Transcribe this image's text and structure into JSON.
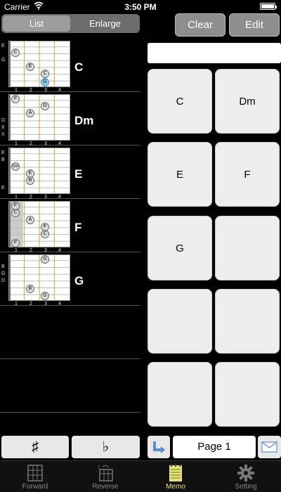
{
  "status": {
    "carrier": "Carrier",
    "time": "3:50 PM"
  },
  "segment": {
    "list": "List",
    "enlarge": "Enlarge"
  },
  "top_buttons": {
    "clear": "Clear",
    "edit": "Edit"
  },
  "chords": [
    {
      "name": "C",
      "open_labels": [
        "E",
        "G"
      ],
      "frets": [
        "1",
        "2",
        "3",
        "4"
      ],
      "dots": [
        "C",
        "E",
        "C",
        "G"
      ]
    },
    {
      "name": "Dm",
      "open_labels": [
        "D",
        "X",
        "X"
      ],
      "frets": [
        "1",
        "2",
        "3",
        "4"
      ],
      "dots": [
        "F",
        "D",
        "A"
      ]
    },
    {
      "name": "E",
      "open_labels": [
        "E",
        "B",
        "E"
      ],
      "frets": [
        "1",
        "2",
        "3",
        "4"
      ],
      "dots": [
        "G#",
        "E",
        "B"
      ]
    },
    {
      "name": "F",
      "open_labels": [],
      "frets": [
        "1",
        "2",
        "3",
        "4"
      ],
      "dots": [
        "F",
        "C",
        "A",
        "F",
        "C",
        "F"
      ]
    },
    {
      "name": "G",
      "open_labels": [
        "B",
        "G",
        "D"
      ],
      "frets": [
        "1",
        "2",
        "3",
        "4"
      ],
      "dots": [
        "G",
        "B",
        "G"
      ]
    }
  ],
  "memo": {
    "cells": [
      "C",
      "Dm",
      "E",
      "F",
      "G",
      "",
      "",
      "",
      "",
      ""
    ],
    "page": "Page 1"
  },
  "accidentals": {
    "sharp": "♯",
    "flat": "♭"
  },
  "tabs": [
    {
      "label": "Forward",
      "icon": "forward-grid-icon"
    },
    {
      "label": "Reverse",
      "icon": "reverse-grid-icon"
    },
    {
      "label": "Memo",
      "icon": "memo-notepad-icon"
    },
    {
      "label": "Setting",
      "icon": "gear-icon"
    }
  ],
  "colors": {
    "active_tab": "#e7e37a",
    "cell_bg": "#ededed",
    "fret_line": "#c9a227"
  }
}
